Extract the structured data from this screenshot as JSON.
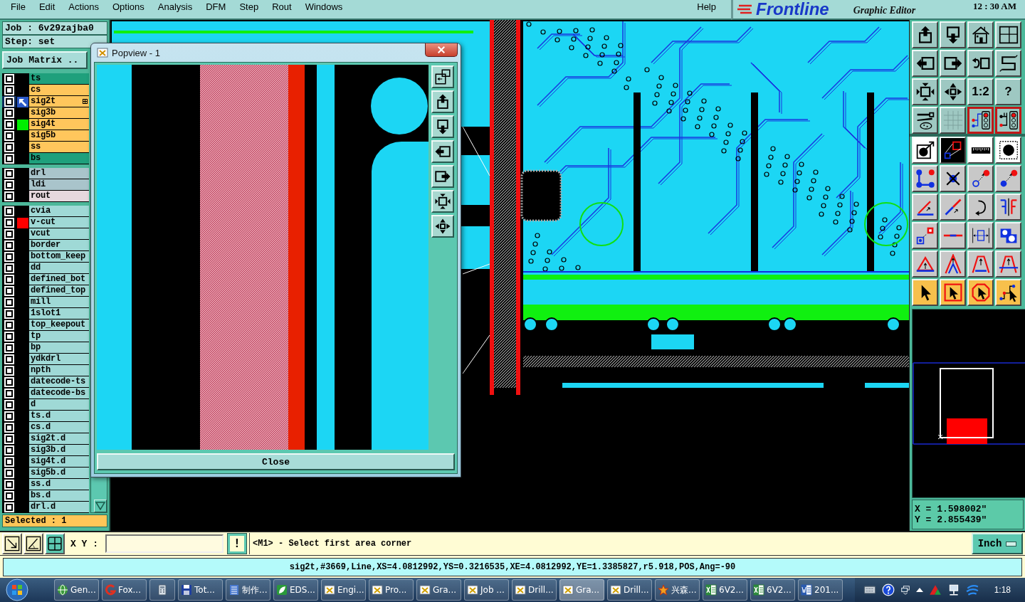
{
  "menu_bar": {
    "items": [
      "File",
      "Edit",
      "Actions",
      "Options",
      "Analysis",
      "DFM",
      "Step",
      "Rout",
      "Windows"
    ],
    "help": "Help"
  },
  "header": {
    "logo": "Frontline",
    "subtitle": "Graphic Editor",
    "clock": "12 : 30 AM"
  },
  "job": {
    "job_label": "Job : 6v29zajba0",
    "step_label": "Step: set",
    "matrix_button": "Job Matrix .."
  },
  "layer_groups": [
    [
      {
        "name": "ts",
        "color": "#1fa07c",
        "checked": false,
        "work_layer": false,
        "marked": false
      },
      {
        "name": "cs",
        "color": "#ffc65c",
        "checked": false,
        "work_layer": false,
        "marked": false
      },
      {
        "name": "sig2t",
        "color": "#ffc65c",
        "checked": false,
        "work_layer": true,
        "marked": true
      },
      {
        "name": "sig3b",
        "color": "#ffc65c",
        "checked": false,
        "work_layer": false,
        "marked": false
      },
      {
        "name": "sig4t",
        "color": "#ffc65c",
        "checked": false,
        "work_layer": false,
        "marked": false,
        "swatch": {
          "color": "#00ee00"
        }
      },
      {
        "name": "sig5b",
        "color": "#ffc65c",
        "checked": false,
        "work_layer": false,
        "marked": false
      },
      {
        "name": "ss",
        "color": "#ffc65c",
        "checked": false,
        "work_layer": false,
        "marked": false
      },
      {
        "name": "bs",
        "color": "#1fa07c",
        "checked": false,
        "work_layer": false,
        "marked": false
      }
    ],
    [
      {
        "name": "drl",
        "color": "#a9c4cb",
        "checked": false,
        "work_layer": false,
        "marked": false
      },
      {
        "name": "ldi",
        "color": "#a9c4cb",
        "checked": false,
        "work_layer": false,
        "marked": false
      },
      {
        "name": "rout",
        "color": "#e6d8de",
        "checked": false,
        "work_layer": false,
        "marked": false
      }
    ],
    [
      {
        "name": "cvia",
        "color": "#9fd9d6",
        "checked": false,
        "work_layer": false,
        "marked": false
      },
      {
        "name": "v-cut",
        "color": "#9fd9d6",
        "checked": false,
        "work_layer": false,
        "marked": false,
        "swatch": {
          "color": "#ff0000"
        }
      },
      {
        "name": "vcut",
        "color": "#9fd9d6",
        "checked": false,
        "work_layer": false,
        "marked": false
      },
      {
        "name": "border",
        "color": "#9fd9d6",
        "checked": false,
        "work_layer": false,
        "marked": false
      },
      {
        "name": "bottom_keep",
        "color": "#9fd9d6",
        "checked": false,
        "work_layer": false,
        "marked": false
      },
      {
        "name": "dd",
        "color": "#9fd9d6",
        "checked": false,
        "work_layer": false,
        "marked": false
      },
      {
        "name": "defined_bot",
        "color": "#9fd9d6",
        "checked": false,
        "work_layer": false,
        "marked": false
      },
      {
        "name": "defined_top",
        "color": "#9fd9d6",
        "checked": false,
        "work_layer": false,
        "marked": false
      },
      {
        "name": "mill",
        "color": "#9fd9d6",
        "checked": false,
        "work_layer": false,
        "marked": false
      },
      {
        "name": "1slot1",
        "color": "#9fd9d6",
        "checked": false,
        "work_layer": false,
        "marked": false
      },
      {
        "name": "top_keepout",
        "color": "#9fd9d6",
        "checked": false,
        "work_layer": false,
        "marked": false
      },
      {
        "name": "tp",
        "color": "#9fd9d6",
        "checked": false,
        "work_layer": false,
        "marked": false
      },
      {
        "name": "bp",
        "color": "#9fd9d6",
        "checked": false,
        "work_layer": false,
        "marked": false
      },
      {
        "name": "ydkdrl",
        "color": "#9fd9d6",
        "checked": false,
        "work_layer": false,
        "marked": false
      },
      {
        "name": "npth",
        "color": "#9fd9d6",
        "checked": false,
        "work_layer": false,
        "marked": false
      },
      {
        "name": "datecode-ts",
        "color": "#9fd9d6",
        "checked": false,
        "work_layer": false,
        "marked": false
      },
      {
        "name": "datecode-bs",
        "color": "#9fd9d6",
        "checked": false,
        "work_layer": false,
        "marked": false
      },
      {
        "name": "d",
        "color": "#9fd9d6",
        "checked": false,
        "work_layer": false,
        "marked": false
      },
      {
        "name": "ts.d",
        "color": "#9fd9d6",
        "checked": false,
        "work_layer": false,
        "marked": false
      },
      {
        "name": "cs.d",
        "color": "#9fd9d6",
        "checked": false,
        "work_layer": false,
        "marked": false
      },
      {
        "name": "sig2t.d",
        "color": "#9fd9d6",
        "checked": false,
        "work_layer": false,
        "marked": false
      },
      {
        "name": "sig3b.d",
        "color": "#9fd9d6",
        "checked": false,
        "work_layer": false,
        "marked": false
      },
      {
        "name": "sig4t.d",
        "color": "#9fd9d6",
        "checked": false,
        "work_layer": false,
        "marked": false
      },
      {
        "name": "sig5b.d",
        "color": "#9fd9d6",
        "checked": false,
        "work_layer": false,
        "marked": false
      },
      {
        "name": "ss.d",
        "color": "#9fd9d6",
        "checked": false,
        "work_layer": false,
        "marked": false
      },
      {
        "name": "bs.d",
        "color": "#9fd9d6",
        "checked": false,
        "work_layer": false,
        "marked": false
      },
      {
        "name": "drl.d",
        "color": "#9fd9d6",
        "checked": false,
        "work_layer": false,
        "marked": false
      }
    ]
  ],
  "selected_count": "Selected : 1",
  "popview": {
    "title": "Popview - 1",
    "close_button": "Close"
  },
  "view_tools": [
    {
      "on": false
    },
    {
      "on": false
    },
    {
      "on": false
    },
    {
      "on": false
    },
    {
      "on": false
    },
    {
      "on": false
    },
    {
      "on": false
    },
    {
      "on": false
    },
    {
      "on": false
    },
    {
      "on": false
    },
    {
      "text": "1:2",
      "on": false
    },
    {
      "text": "?",
      "on": false
    },
    {
      "on": false
    },
    {
      "on": false
    },
    {
      "on": true
    },
    {
      "on": true
    }
  ],
  "coordinates": {
    "x": "X = 1.598002\"",
    "y": "Y = 2.855439\""
  },
  "command_bar": {
    "label": "X Y :",
    "alert_button": "!",
    "message": "<M1> - Select first area corner",
    "units": "Inch"
  },
  "status_line": "sig2t,#3669,Line,XS=4.0812992,YS=0.3216535,XE=4.0812992,YE=1.3385827,r5.918,POS,Ang=-90",
  "taskbar": {
    "items": [
      {
        "kind": "globe",
        "label": "Gen...",
        "selected": false
      },
      {
        "kind": "swirl",
        "label": "Fox...",
        "selected": false
      },
      {
        "kind": "calculator",
        "selected": false
      },
      {
        "kind": "disk",
        "label": "Tot...",
        "selected": false
      },
      {
        "kind": "list",
        "label": "制作...",
        "selected": false
      },
      {
        "kind": "tile",
        "label": "EDS...",
        "selected": false
      },
      {
        "kind": "xwindow",
        "label": "Engi...",
        "selected": false
      },
      {
        "kind": "xwindow",
        "label": "Pro...",
        "selected": false
      },
      {
        "kind": "xwindow",
        "label": "Gra...",
        "selected": false
      },
      {
        "kind": "xwindow",
        "label": "Job ...",
        "selected": false
      },
      {
        "kind": "xwindow",
        "label": "Drill...",
        "selected": false
      },
      {
        "kind": "xwindow",
        "label": "Gra...",
        "selected": true
      },
      {
        "kind": "xwindow",
        "label": "Drill...",
        "selected": false
      },
      {
        "kind": "star",
        "label": "兴森...",
        "selected": false
      },
      {
        "kind": "sheet",
        "label": "6V2...",
        "selected": false
      },
      {
        "kind": "sheet",
        "label": "6V2...",
        "selected": false
      },
      {
        "kind": "doc",
        "label": "201...",
        "selected": false
      }
    ],
    "clock": "1:18"
  }
}
